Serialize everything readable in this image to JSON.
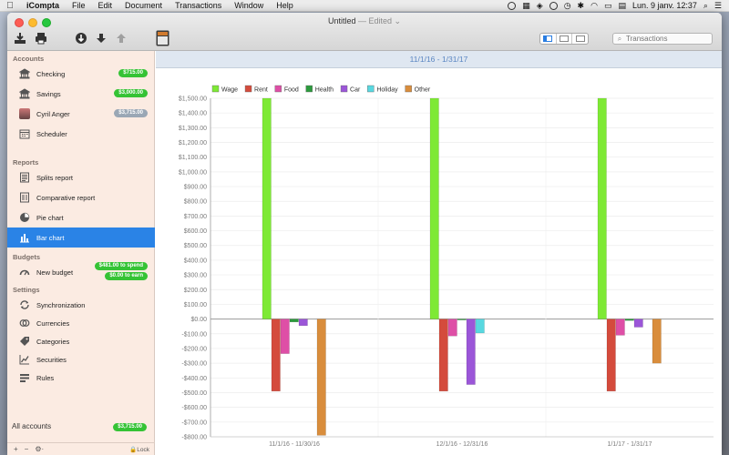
{
  "menubar": {
    "app": "iCompta",
    "menus": [
      "File",
      "Edit",
      "Document",
      "Transactions",
      "Window",
      "Help"
    ],
    "clock": "Lun. 9 janv.  12:37"
  },
  "window": {
    "title": "Untitled",
    "edited": "— Edited ⌄"
  },
  "toolbar": {
    "search_placeholder": "Transactions"
  },
  "sidebar": {
    "sections": {
      "accounts": "Accounts",
      "reports": "Reports",
      "budgets": "Budgets",
      "settings": "Settings"
    },
    "accounts": [
      {
        "label": "Checking",
        "badge": "$715.00",
        "icon": "bank-icon"
      },
      {
        "label": "Savings",
        "badge": "$3,000.00",
        "icon": "bank-icon"
      },
      {
        "label": "Cyril Anger",
        "badge": "$3,715.00",
        "icon": "avatar"
      },
      {
        "label": "Scheduler",
        "badge": "",
        "icon": "calendar-icon"
      }
    ],
    "reports": [
      {
        "label": "Splits report",
        "icon": "list-report-icon"
      },
      {
        "label": "Comparative report",
        "icon": "compare-report-icon"
      },
      {
        "label": "Pie chart",
        "icon": "pie-chart-icon"
      },
      {
        "label": "Bar chart",
        "icon": "bar-chart-icon"
      }
    ],
    "budget": {
      "label": "New budget",
      "badge_spend": "$481.00 to spend",
      "badge_earn": "$0.00 to earn"
    },
    "settings": [
      {
        "label": "Synchronization",
        "icon": "sync-icon"
      },
      {
        "label": "Currencies",
        "icon": "currencies-icon"
      },
      {
        "label": "Categories",
        "icon": "tag-icon"
      },
      {
        "label": "Securities",
        "icon": "securities-icon"
      },
      {
        "label": "Rules",
        "icon": "rules-icon"
      }
    ],
    "all_accounts": {
      "label": "All accounts",
      "badge": "$3,715.00"
    },
    "bottom": {
      "add": "+",
      "remove": "−",
      "gear": "⚙︎·",
      "lock": "🔒Lock"
    }
  },
  "content": {
    "date_range": "11/1/16 - 1/31/17"
  },
  "chart_data": {
    "type": "bar",
    "categories": [
      "11/1/16 - 11/30/16",
      "12/1/16 - 12/31/16",
      "1/1/17 - 1/31/17"
    ],
    "series": [
      {
        "name": "Wage",
        "color": "#7ee935",
        "values": [
          1500,
          1500,
          1500
        ]
      },
      {
        "name": "Rent",
        "color": "#d44b3c",
        "values": [
          -490,
          -490,
          -490
        ]
      },
      {
        "name": "Food",
        "color": "#de4fa6",
        "values": [
          -235,
          -115,
          -110
        ]
      },
      {
        "name": "Health",
        "color": "#2c9a3d",
        "values": [
          -20,
          -5,
          -10
        ]
      },
      {
        "name": "Car",
        "color": "#9b56d8",
        "values": [
          -45,
          -445,
          -55
        ]
      },
      {
        "name": "Holiday",
        "color": "#58d8e0",
        "values": [
          0,
          -95,
          0
        ]
      },
      {
        "name": "Other",
        "color": "#d98d3c",
        "values": [
          -790,
          0,
          -300
        ]
      }
    ],
    "ylim": [
      -800,
      1500
    ],
    "ytick_step": 100,
    "grid": true,
    "legend_position": "top-left"
  }
}
